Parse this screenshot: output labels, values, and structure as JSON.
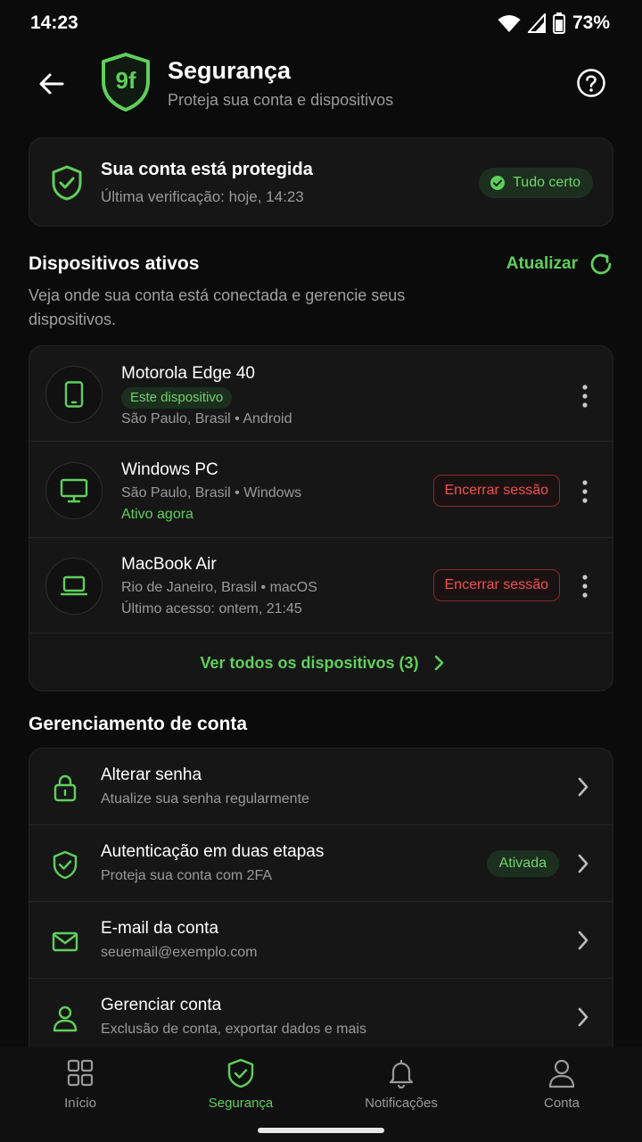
{
  "status_bar": {
    "time": "14:23",
    "battery": "73%"
  },
  "header": {
    "title": "Segurança",
    "subtitle": "Proteja sua conta e dispositivos",
    "logo_text": "9f"
  },
  "status_card": {
    "title": "Sua conta está protegida",
    "subtitle": "Última verificação: hoje, 14:23",
    "badge": "Tudo certo"
  },
  "devices_section": {
    "title": "Dispositivos ativos",
    "description": "Veja onde sua conta está conectada e gerencie seus dispositivos.",
    "refresh_label": "Atualizar",
    "devices": [
      {
        "name": "Motorola Edge 40",
        "chip": "Este dispositivo",
        "meta": "São Paulo, Brasil • Android",
        "icon": "smartphone-icon"
      },
      {
        "name": "Windows PC",
        "meta": "São Paulo, Brasil • Windows",
        "status": "Ativo agora",
        "end_label": "Encerrar sessão",
        "icon": "monitor-icon"
      },
      {
        "name": "MacBook Air",
        "meta": "Rio de Janeiro, Brasil • macOS",
        "status": "Último acesso: ontem, 21:45",
        "end_label": "Encerrar sessão",
        "icon": "laptop-icon"
      }
    ],
    "see_all": "Ver todos os dispositivos (3)"
  },
  "account_section": {
    "title": "Gerenciamento de conta",
    "items": [
      {
        "title": "Alterar senha",
        "subtitle": "Atualize sua senha regularmente",
        "icon": "lock-icon"
      },
      {
        "title": "Autenticação em duas etapas",
        "subtitle": "Proteja sua conta com 2FA",
        "chip": "Ativada",
        "icon": "shield-check-icon"
      },
      {
        "title": "E-mail da conta",
        "subtitle": "seuemail@exemplo.com",
        "icon": "mail-icon"
      },
      {
        "title": "Gerenciar conta",
        "subtitle": "Exclusão de conta, exportar dados e mais",
        "icon": "user-icon"
      }
    ]
  },
  "bottom_nav": [
    {
      "label": "Início",
      "icon": "grid-icon"
    },
    {
      "label": "Segurança",
      "icon": "shield-icon",
      "active": true
    },
    {
      "label": "Notificações",
      "icon": "bell-icon"
    },
    {
      "label": "Conta",
      "icon": "user-icon"
    }
  ],
  "colors": {
    "accent": "#5fcf5c",
    "danger": "#f0514f",
    "background": "#0b0b0b",
    "card": "#161616"
  }
}
